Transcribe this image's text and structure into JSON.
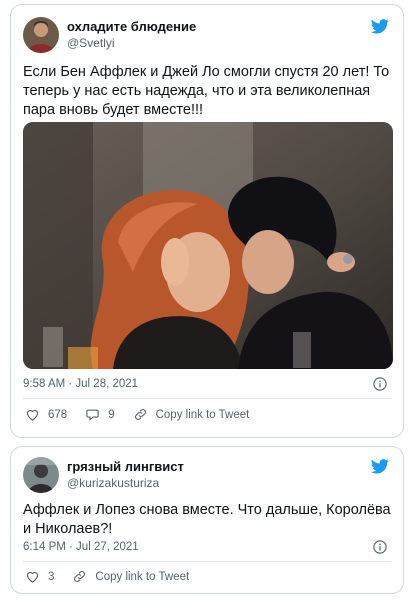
{
  "tweets": [
    {
      "author_name": "охладите блюдение",
      "handle": "@Svetlyi",
      "text": "Если Бен Аффлек и Джей Ло смогли спустя 20 лет! То теперь у нас есть надежда, что и эта великолепная пара вновь будет вместе!!!",
      "timestamp": "9:58 AM · Jul 28, 2021",
      "likes": "678",
      "replies": "9",
      "copy_link_label": "Copy link to Tweet",
      "icons": {
        "brand": "twitter-bird-icon",
        "info": "info-icon",
        "like": "heart-icon",
        "reply": "reply-icon",
        "link": "link-icon"
      }
    },
    {
      "author_name": "грязный лингвист",
      "handle": "@kurizakusturiza",
      "text": "Аффлек и Лопез снова вместе. Что дальше, Королёва и Николаев?!",
      "timestamp": "6:14 PM · Jul 27, 2021",
      "likes": "3",
      "copy_link_label": "Copy link to Tweet",
      "icons": {
        "brand": "twitter-bird-icon",
        "info": "info-icon",
        "like": "heart-icon",
        "link": "link-icon"
      }
    }
  ],
  "colors": {
    "brand": "#1d9bf0",
    "secondary_text": "#536471",
    "border": "#cfd9de"
  }
}
